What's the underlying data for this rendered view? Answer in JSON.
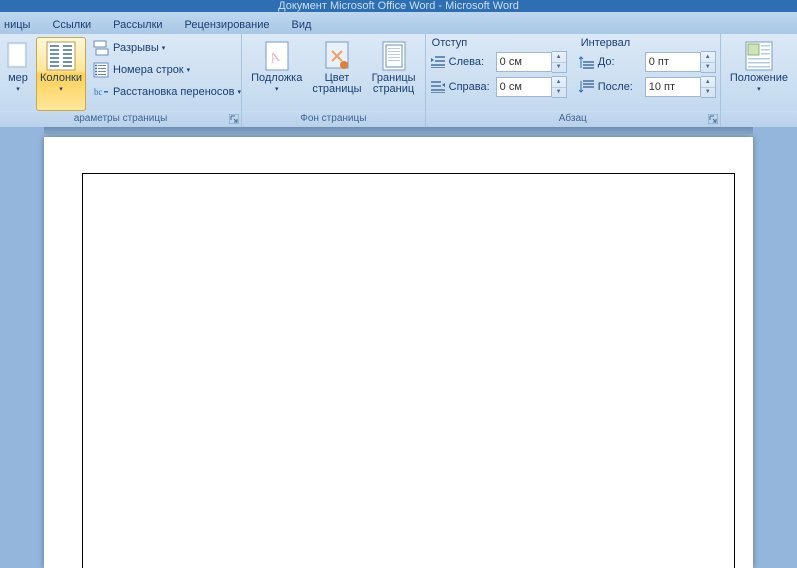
{
  "titlebar": "Документ Microsoft Office Word - Microsoft Word",
  "tabs": {
    "t0": "ницы",
    "t1": "Ссылки",
    "t2": "Рассылки",
    "t3": "Рецензирование",
    "t4": "Вид"
  },
  "groups": {
    "page_setup": {
      "size_btn": "мер",
      "columns_btn": "Колонки",
      "breaks": "Разрывы",
      "line_numbers": "Номера строк",
      "hyphenation": "Расстановка переносов",
      "label": "араметры страницы"
    },
    "page_bg": {
      "watermark": "Подложка",
      "page_color": "Цвет\nстраницы",
      "borders": "Границы\nстраниц",
      "label": "Фон страницы"
    },
    "paragraph": {
      "indent_title": "Отступ",
      "spacing_title": "Интервал",
      "left_label": "Слева:",
      "right_label": "Справа:",
      "before_label": "До:",
      "after_label": "После:",
      "left_val": "0 см",
      "right_val": "0 см",
      "before_val": "0 пт",
      "after_val": "10 пт",
      "label": "Абзац"
    },
    "arrange": {
      "position": "Положение",
      "label": ""
    }
  }
}
